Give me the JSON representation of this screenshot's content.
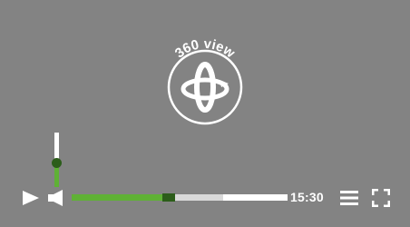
{
  "badge": {
    "label": "360 view",
    "icon": "rotate-360-icon",
    "color": "#ffffff"
  },
  "volume": {
    "level": 0.45,
    "icon": "speaker-icon"
  },
  "playback": {
    "play_icon": "play-icon",
    "played": 0.45,
    "buffered": 0.7,
    "time": "15:30"
  },
  "buttons": {
    "menu_icon": "menu-icon",
    "fullscreen_icon": "fullscreen-icon"
  },
  "colors": {
    "background": "#838383",
    "accent": "#5fb135",
    "accent_dark": "#2c5d1a",
    "track": "#ffffff",
    "buffer": "#d9d9d9"
  }
}
